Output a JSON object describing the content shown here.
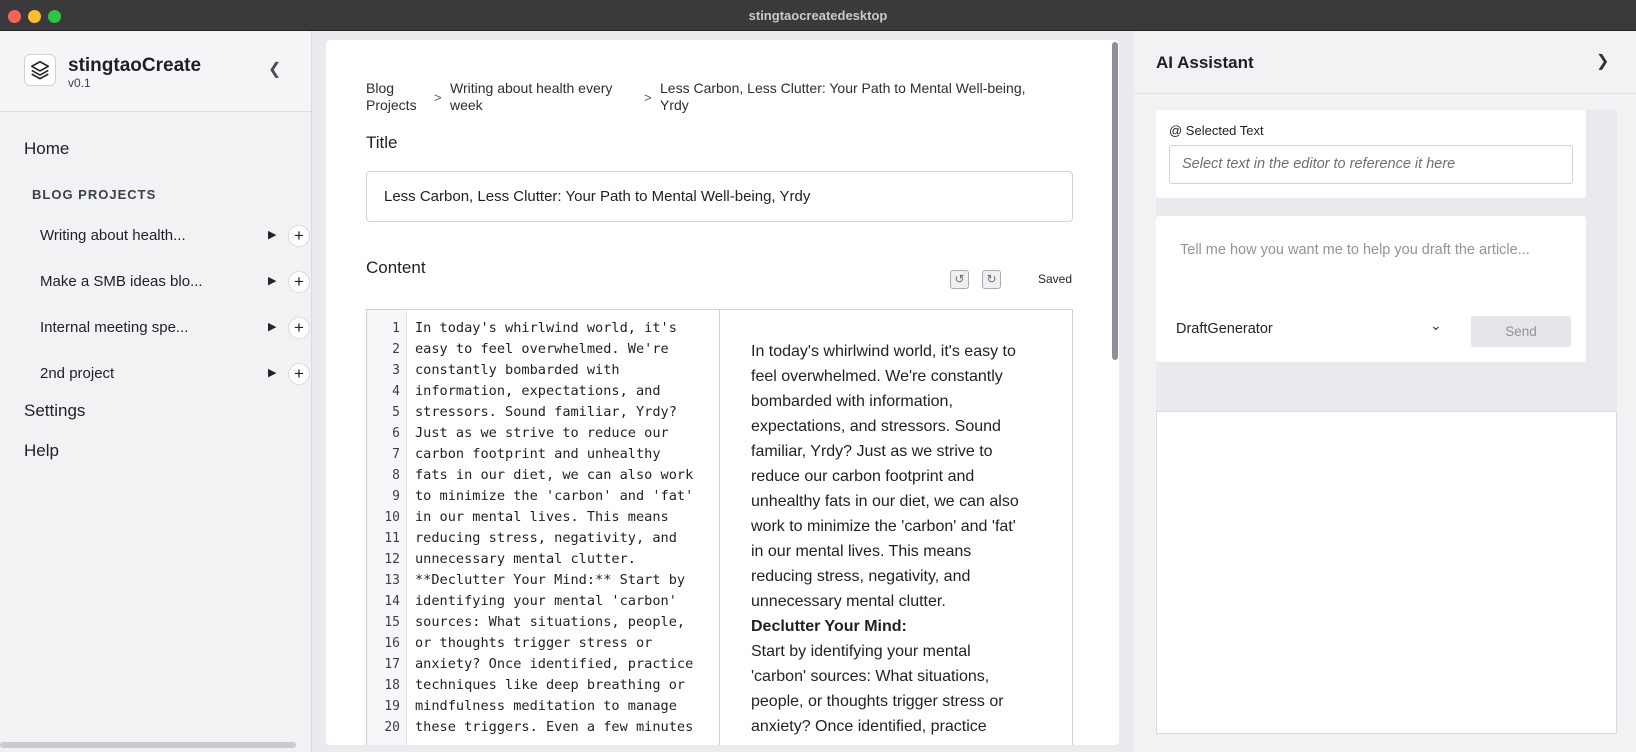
{
  "window": {
    "title": "stingtaocreatedesktop"
  },
  "sidebar": {
    "app_name": "stingtaoCreate",
    "version": "v0.1",
    "home": "Home",
    "section_heading": "BLOG PROJECTS",
    "projects": [
      {
        "label": "Writing about health..."
      },
      {
        "label": "Make a SMB ideas blo..."
      },
      {
        "label": "Internal meeting spe..."
      },
      {
        "label": "2nd project"
      }
    ],
    "settings": "Settings",
    "help": "Help",
    "icons": {
      "logo": "layers-icon",
      "collapse": "chevron-left-icon",
      "expand": "triangle-right-icon",
      "add": "plus-icon"
    }
  },
  "breadcrumb": {
    "items": [
      {
        "line1": "Blog",
        "line2": "Projects"
      },
      {
        "line1": "Writing about health every",
        "line2": "week"
      },
      {
        "line1": "Less Carbon, Less Clutter: Your Path to Mental Well-being,",
        "line2": "Yrdy"
      }
    ],
    "separator": ">"
  },
  "editor": {
    "title_label": "Title",
    "title_value": "Less Carbon, Less Clutter: Your Path to Mental Well-being, Yrdy",
    "content_label": "Content",
    "save_status": "Saved",
    "line_numbers": [
      "1",
      "2",
      "3",
      "4",
      "5",
      "6",
      "7",
      "8",
      "9",
      "10",
      "11",
      "12",
      "13",
      "14",
      "15",
      "16",
      "17",
      "18",
      "19",
      "20"
    ],
    "code_lines": [
      "In today's whirlwind world, it's",
      "easy to feel overwhelmed. We're",
      "constantly bombarded with",
      "information, expectations, and",
      "stressors. Sound familiar, Yrdy?",
      "Just as we strive to reduce our",
      "carbon footprint and unhealthy",
      "fats in our diet, we can also work",
      "to minimize the 'carbon' and 'fat'",
      "in our mental lives. This means",
      "reducing stress, negativity, and",
      "unnecessary mental clutter.",
      "**Declutter Your Mind:** Start by",
      "identifying your mental 'carbon'",
      "sources: What situations, people,",
      "or thoughts trigger stress or",
      "anxiety? Once identified, practice",
      "techniques like deep breathing or",
      "mindfulness meditation to manage",
      "these triggers. Even a few minutes"
    ],
    "preview_lines": [
      {
        "text": "In today's whirlwind world, it's easy to",
        "bold": false
      },
      {
        "text": "feel overwhelmed. We're constantly",
        "bold": false
      },
      {
        "text": "bombarded with information,",
        "bold": false
      },
      {
        "text": "expectations, and stressors. Sound",
        "bold": false
      },
      {
        "text": "familiar, Yrdy? Just as we strive to",
        "bold": false
      },
      {
        "text": "reduce our carbon footprint and",
        "bold": false
      },
      {
        "text": "unhealthy fats in our diet, we can also",
        "bold": false
      },
      {
        "text": "work to minimize the 'carbon' and 'fat'",
        "bold": false
      },
      {
        "text": "in our mental lives. This means",
        "bold": false
      },
      {
        "text": "reducing stress, negativity, and",
        "bold": false
      },
      {
        "text": "unnecessary mental clutter.",
        "bold": false
      },
      {
        "text": "Declutter Your Mind:",
        "bold": true
      },
      {
        "text": "Start by identifying your mental",
        "bold": false
      },
      {
        "text": "'carbon' sources: What situations,",
        "bold": false
      },
      {
        "text": "people, or thoughts trigger stress or",
        "bold": false
      },
      {
        "text": "anxiety? Once identified, practice",
        "bold": false
      }
    ]
  },
  "assistant": {
    "title": "AI Assistant",
    "selected_label": "@ Selected Text",
    "selected_placeholder": "Select text in the editor to reference it here",
    "prompt_placeholder": "Tell me how you want me to help you draft the article...",
    "model": "DraftGenerator",
    "send_label": "Send",
    "icons": {
      "close": "chevron-right-icon",
      "dropdown": "chevron-down-icon"
    }
  }
}
